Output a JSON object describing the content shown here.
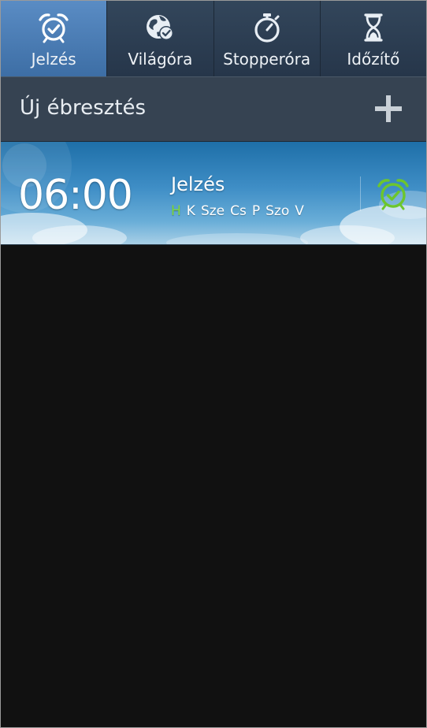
{
  "tabs": [
    {
      "label": "Jelzés",
      "icon": "alarm-clock-icon",
      "active": true
    },
    {
      "label": "Világóra",
      "icon": "globe-icon",
      "active": false
    },
    {
      "label": "Stopperóra",
      "icon": "stopwatch-icon",
      "active": false
    },
    {
      "label": "Időzítő",
      "icon": "hourglass-icon",
      "active": false
    }
  ],
  "new_alarm": {
    "label": "Új ébresztés",
    "icon": "plus-icon"
  },
  "alarms": [
    {
      "time": "06:00",
      "name": "Jelzés",
      "days": [
        {
          "label": "H",
          "active": true
        },
        {
          "label": "K",
          "active": false
        },
        {
          "label": "Sze",
          "active": false
        },
        {
          "label": "Cs",
          "active": false
        },
        {
          "label": "P",
          "active": false
        },
        {
          "label": "Szo",
          "active": false
        },
        {
          "label": "V",
          "active": false
        }
      ],
      "enabled": true,
      "toggle_icon": "alarm-on-icon"
    }
  ],
  "colors": {
    "active_tab": "#4a7db5",
    "active_day": "#7ed83a",
    "alarm_on": "#6cc62d"
  }
}
